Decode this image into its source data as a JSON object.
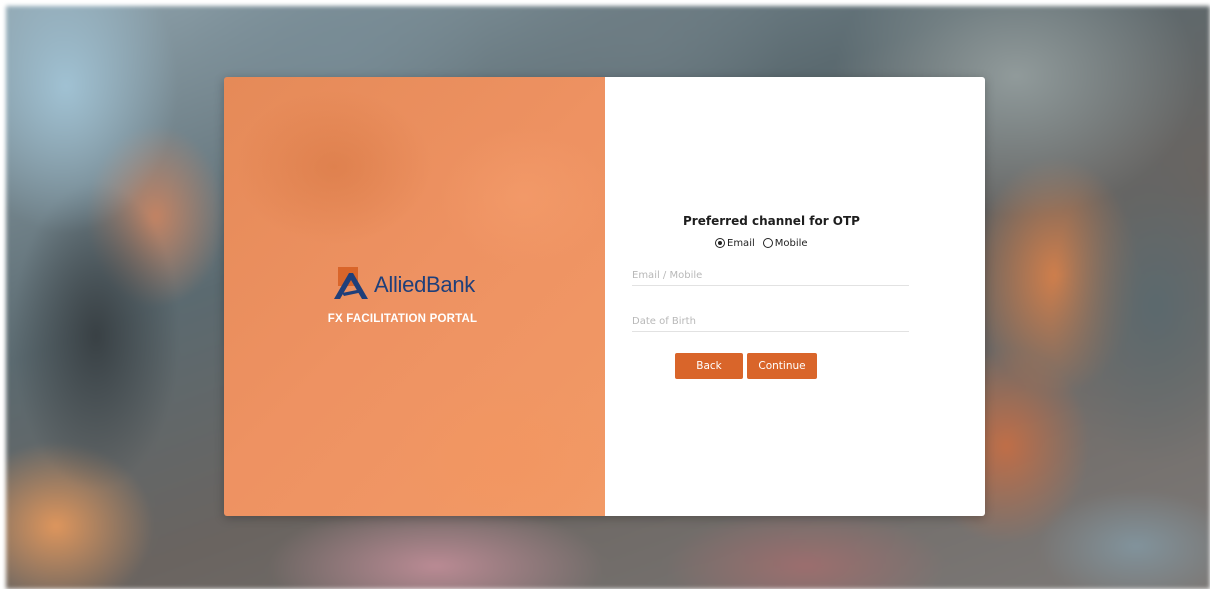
{
  "colors": {
    "brand_orange": "#d9652a",
    "panel_orange": "#ee9262",
    "logo_blue": "#1f3f7a"
  },
  "brand": {
    "logo_icon": "allied-bank-logo-icon",
    "bank_name": "AlliedBank",
    "portal_title": "FX FACILITATION PORTAL"
  },
  "otp": {
    "title": "Preferred channel for OTP",
    "options": [
      {
        "label": "Email",
        "selected": true
      },
      {
        "label": "Mobile",
        "selected": false
      }
    ]
  },
  "fields": {
    "email_mobile": {
      "placeholder": "Email / Mobile",
      "value": ""
    },
    "dob": {
      "placeholder": "Date of Birth",
      "value": ""
    }
  },
  "buttons": {
    "back": "Back",
    "continue": "Continue"
  }
}
